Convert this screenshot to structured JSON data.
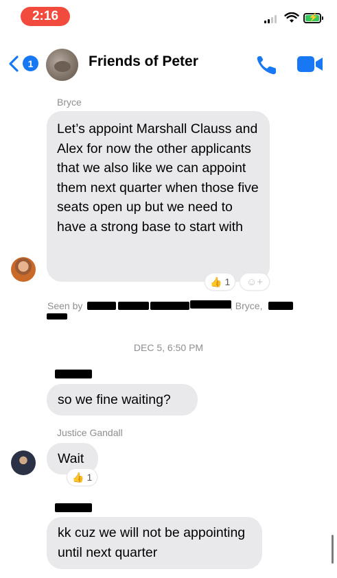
{
  "status_bar": {
    "time": "2:16"
  },
  "header": {
    "back_badge_count": "1",
    "chat_title": "Friends of Peter"
  },
  "messages": [
    {
      "sender": "Bryce",
      "text": "Let’s appoint Marshall Clauss and Alex for now the other applicants that we also like we can appoint them next quarter when those five seats open up but we need to have a strong base to start with",
      "reaction_count": "1"
    },
    {
      "text": "so we fine waiting?"
    },
    {
      "sender": "Justice Gandall",
      "text": "Wait",
      "reaction_count": "1"
    },
    {
      "text": "kk cuz we will not be appointing until next quarter"
    }
  ],
  "seen": {
    "label": "Seen by",
    "visible_name": ", Bryce,"
  },
  "timestamp": "DEC 5, 6:50 PM",
  "colors": {
    "accent": "#1877f2",
    "bubble_gray": "#e9e9eb",
    "time_pill": "#f24a3c",
    "meta_text": "#8e8e93"
  },
  "icons": [
    "back-chevron-icon",
    "phone-icon",
    "video-camera-icon",
    "thumbs-up-icon",
    "add-reaction-icon",
    "wifi-icon",
    "battery-icon",
    "signal-icon"
  ]
}
